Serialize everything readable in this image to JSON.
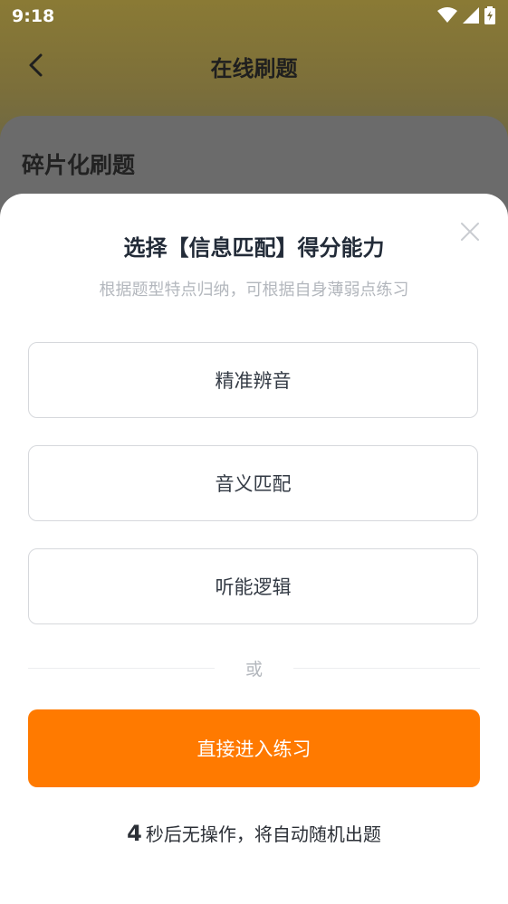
{
  "status_bar": {
    "time": "9:18"
  },
  "header": {
    "title": "在线刷题"
  },
  "page": {
    "section_title": "碎片化刷题"
  },
  "sheet": {
    "title": "选择【信息匹配】得分能力",
    "subtitle": "根据题型特点归纳，可根据自身薄弱点练习",
    "options": [
      {
        "label": "精准辨音"
      },
      {
        "label": "音义匹配"
      },
      {
        "label": "听能逻辑"
      }
    ],
    "divider_text": "或",
    "primary_button": "直接进入练习",
    "countdown": {
      "seconds": "4",
      "text": "秒后无操作，将自动随机出题"
    }
  },
  "colors": {
    "accent": "#ff7a00"
  }
}
